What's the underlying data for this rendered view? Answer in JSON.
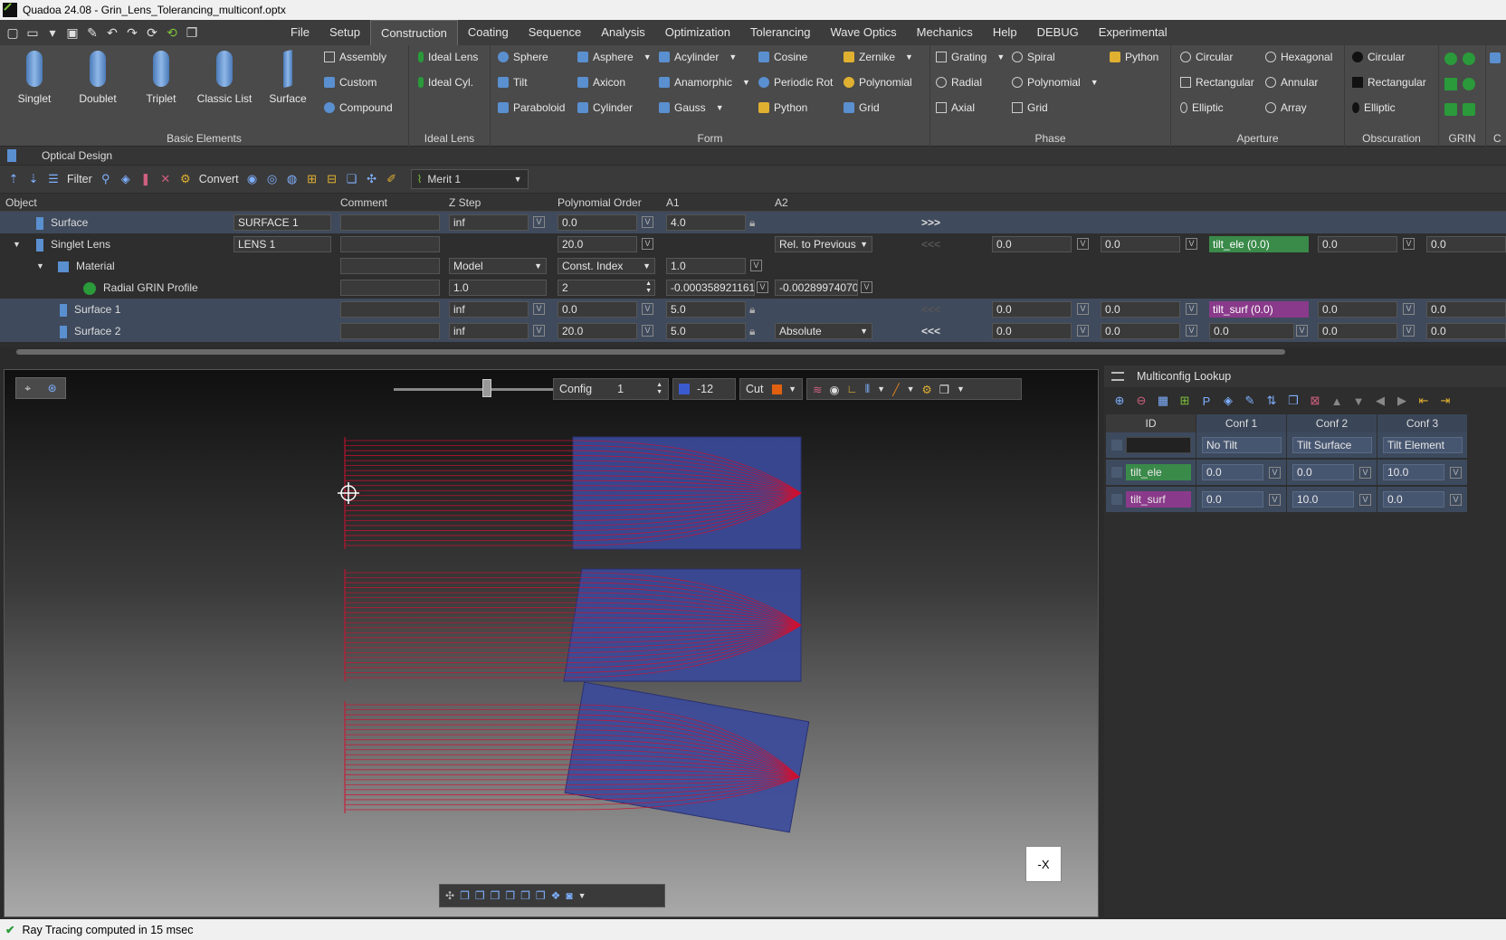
{
  "window": {
    "title": "Quadoa 24.08 - Grin_Lens_Tolerancing_multiconf.optx"
  },
  "menu": [
    "File",
    "Setup",
    "Construction",
    "Coating",
    "Sequence",
    "Analysis",
    "Optimization",
    "Tolerancing",
    "Wave Optics",
    "Mechanics",
    "Help",
    "DEBUG",
    "Experimental"
  ],
  "menu_active": "Construction",
  "ribbon": {
    "basic": {
      "title": "Basic Elements",
      "big": [
        "Singlet",
        "Doublet",
        "Triplet",
        "Classic List",
        "Surface"
      ],
      "small": [
        "Assembly",
        "Custom",
        "Compound"
      ]
    },
    "ideal": {
      "title": "Ideal Lens",
      "items": [
        "Ideal Lens",
        "Ideal Cyl."
      ]
    },
    "form": {
      "title": "Form",
      "items": [
        "Sphere",
        "Tilt",
        "Paraboloid",
        "Asphere",
        "Axicon",
        "Cylinder",
        "Acylinder",
        "Anamorphic",
        "Gauss",
        "Cosine",
        "Periodic Rot",
        "Python",
        "Zernike",
        "Polynomial",
        "Grid"
      ]
    },
    "phase": {
      "title": "Phase",
      "items": [
        "Grating",
        "Radial",
        "Axial",
        "Spiral",
        "Polynomial",
        "Grid",
        "Python"
      ]
    },
    "aperture": {
      "title": "Aperture",
      "items": [
        "Circular",
        "Rectangular",
        "Elliptic",
        "Hexagonal",
        "Annular",
        "Array"
      ]
    },
    "obscuration": {
      "title": "Obscuration",
      "items": [
        "Circular",
        "Rectangular",
        "Elliptic"
      ]
    },
    "grin": {
      "title": "GRIN"
    },
    "clipped": {
      "title": "C"
    }
  },
  "optical_design": {
    "title": "Optical Design",
    "toolbar": {
      "filter": "Filter",
      "convert": "Convert",
      "merit": "Merit 1"
    },
    "columns": [
      "Object",
      "Comment",
      "Z Step",
      "Polynomial Order",
      "A1",
      "A2"
    ],
    "rows": [
      {
        "name": "Surface",
        "obj": "SURFACE 1",
        "z": "inf",
        "po": "0.0",
        "a1": "4.0",
        "extra": ">>>"
      },
      {
        "name": "Singlet Lens",
        "obj": "LENS 1",
        "po": "20.0",
        "a2": "Rel. to Previous",
        "extra": "<<<",
        "v1": "0.0",
        "v2": "0.0",
        "tag": "tilt_ele (0.0)",
        "v3": "0.0",
        "v4": "0.0"
      },
      {
        "name": "Material",
        "z": "Model",
        "po": "Const. Index",
        "a1": "1.0"
      },
      {
        "name": "Radial GRIN Profile",
        "z": "1.0",
        "po": "2",
        "a1": "-0.000358921161",
        "a2": "-0.002899740707"
      },
      {
        "name": "Surface 1",
        "z": "inf",
        "po": "0.0",
        "a1": "5.0",
        "extra": "<<<",
        "v1": "0.0",
        "v2": "0.0",
        "tag": "tilt_surf (0.0)",
        "v3": "0.0",
        "v4": "0.0"
      },
      {
        "name": "Surface 2",
        "z": "inf",
        "po": "20.0",
        "a1": "5.0",
        "a2": "Absolute",
        "extra": "<<<",
        "v1": "0.0",
        "v2": "0.0",
        "v3": "0.0",
        "v4": "0.0",
        "v5": "0.0"
      }
    ]
  },
  "viewport": {
    "config_label": "Config",
    "config_value": "1",
    "field_value": "-12",
    "cut_label": "Cut",
    "axis_button": "-X",
    "slider": 0.5
  },
  "multiconfig": {
    "title": "Multiconfig Lookup",
    "headers": [
      "ID",
      "Conf 1",
      "Conf 2",
      "Conf 3"
    ],
    "names": [
      "No Tilt",
      "Tilt Surface",
      "Tilt Element"
    ],
    "rows": [
      {
        "id": "tilt_ele",
        "vals": [
          "0.0",
          "0.0",
          "10.0"
        ],
        "color": "#3a8a4a"
      },
      {
        "id": "tilt_surf",
        "vals": [
          "0.0",
          "10.0",
          "0.0"
        ],
        "color": "#8a3a8a"
      }
    ]
  },
  "status": {
    "text": "Ray Tracing computed in 15 msec"
  }
}
